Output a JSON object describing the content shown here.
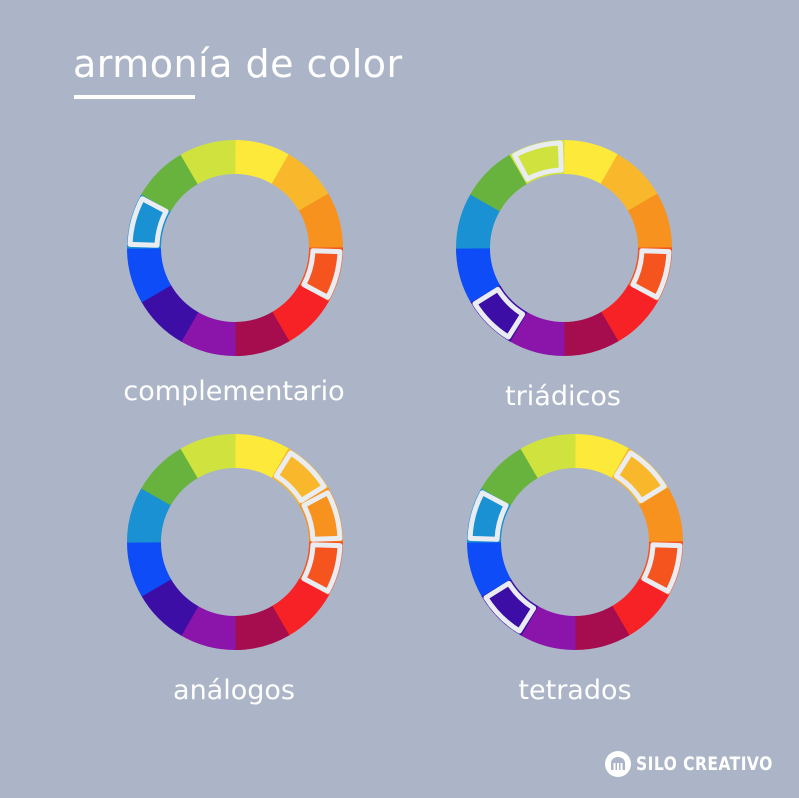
{
  "title": "armonía de color",
  "colors": {
    "background": "#abb5c7",
    "text": "#ffffff",
    "highlight_stroke": "#e9ecf1",
    "wheel_segments": [
      "#fde93a",
      "#f9b82b",
      "#f7921f",
      "#f5541f",
      "#f62225",
      "#a50d4f",
      "#8b15ab",
      "#3d0ea5",
      "#0d4cf7",
      "#1a91d2",
      "#68b33d",
      "#d0e23d"
    ]
  },
  "wheels": [
    {
      "label": "complementario",
      "highlighted": [
        3,
        9
      ]
    },
    {
      "label": "triádicos",
      "highlighted": [
        3,
        7,
        11
      ]
    },
    {
      "label": "análogos",
      "highlighted": [
        1,
        2,
        3
      ]
    },
    {
      "label": "tetrados",
      "highlighted": [
        1,
        3,
        7,
        9
      ]
    }
  ],
  "brand": {
    "name": "SILO CREATIVO",
    "icon": "silo-logo-icon"
  }
}
